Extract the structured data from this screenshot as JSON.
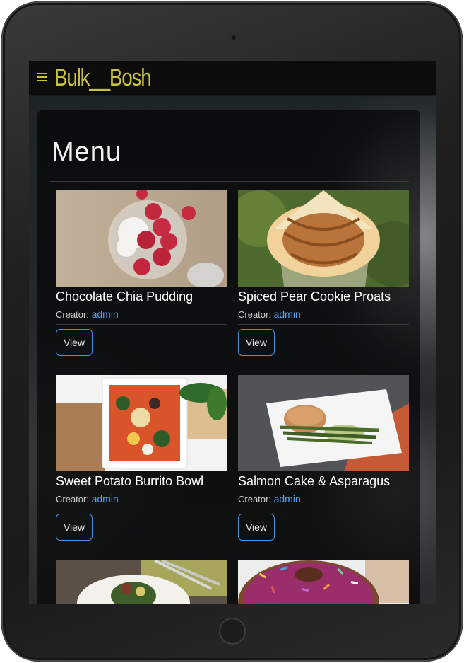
{
  "app": {
    "brand": "Bulk__Bosh"
  },
  "page": {
    "title": "Menu"
  },
  "recipes": [
    {
      "name": "Chocolate Chia Pudding",
      "creator_label": "Creator:",
      "creator": "admin",
      "view_label": "View",
      "photo": "chia-pudding-photo"
    },
    {
      "name": "Spiced Pear Cookie Proats",
      "creator_label": "Creator:",
      "creator": "admin",
      "view_label": "View",
      "photo": "pear-proats-photo"
    },
    {
      "name": "Sweet Potato Burrito Bowl",
      "creator_label": "Creator:",
      "creator": "admin",
      "view_label": "View",
      "photo": "burrito-bowl-photo"
    },
    {
      "name": "Salmon Cake & Asparagus",
      "creator_label": "Creator:",
      "creator": "admin",
      "view_label": "View",
      "photo": "salmon-cake-photo"
    }
  ],
  "partial_cards": [
    {
      "photo": "salad-plate-photo"
    },
    {
      "photo": "sprinkle-donut-photo"
    }
  ],
  "colors": {
    "brand": "#c9c23a",
    "link": "#5aa0f0",
    "button_border": "#4a90e2"
  },
  "icons": {
    "menu": "hamburger-menu-icon"
  }
}
